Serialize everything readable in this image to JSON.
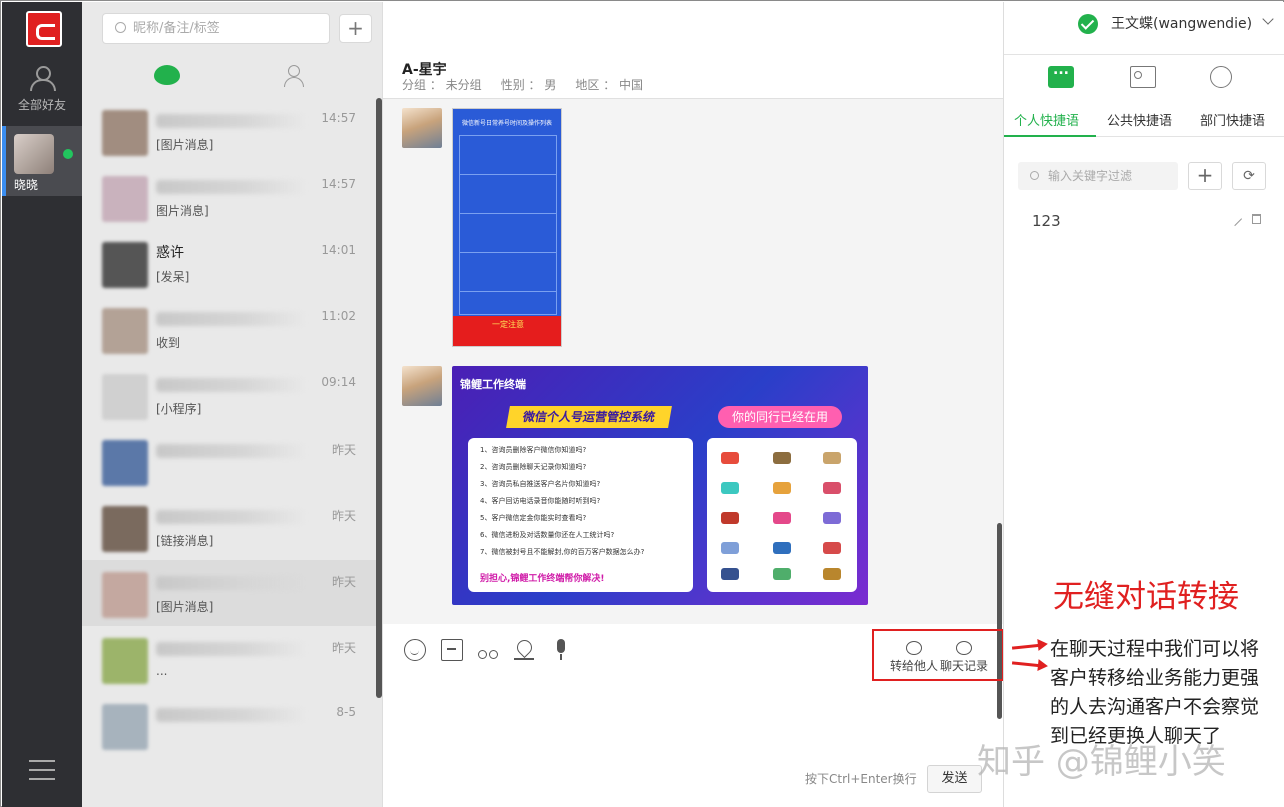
{
  "sidebar": {
    "all_friends_label": "全部好友",
    "user_name": "晓晓"
  },
  "list": {
    "search_placeholder": "昵称/备注/标签",
    "add_label": "+",
    "conversations": [
      {
        "name": "",
        "message": "[图片消息]",
        "time": "14:57",
        "color": "#a18d80"
      },
      {
        "name": "",
        "message": "图片消息]",
        "time": "14:57",
        "color": "#c9b2bd"
      },
      {
        "name": "惑许",
        "message": "[发呆]",
        "time": "14:01",
        "color": "#555555"
      },
      {
        "name": "",
        "message": "收到",
        "time": "11:02",
        "color": "#b3a296"
      },
      {
        "name": "",
        "message": "[小程序]",
        "time": "09:14",
        "color": "#d0d0d0"
      },
      {
        "name": "",
        "message": "",
        "time": "昨天",
        "color": "#5b78a8"
      },
      {
        "name": "",
        "message": "[链接消息]",
        "time": "昨天",
        "color": "#7a6a5e"
      },
      {
        "name": "",
        "message": "[图片消息]",
        "time": "昨天",
        "color": "#c4a8a0"
      },
      {
        "name": "",
        "message": "...",
        "time": "昨天",
        "color": "#9cb46a"
      },
      {
        "name": "",
        "message": "",
        "time": "8-5",
        "color": "#a7b3bd"
      }
    ]
  },
  "chat": {
    "title": "A-星宇",
    "meta": "分组 ： 未分组     性别 ： 男     地区 ： 中国",
    "image1": {
      "title": "微信新号日常养号时间及操作列表",
      "warning": "一定注意"
    },
    "image2": {
      "brand": "锦鲤工作终端",
      "banner_left": "微信个人号运营管控系统",
      "banner_right": "你的同行已经在用",
      "questions": [
        "1、咨询员删除客户微信你知道吗?",
        "2、咨询员删除聊天记录你知道吗?",
        "3、咨询员私自推送客户名片你知道吗?",
        "4、客户回访电话录音你能随时听到吗?",
        "5、客户微信定金你能实时查看吗?",
        "6、微信进粉及对话数量你还在人工统计吗?",
        "7、微信被封号且不能解封,你的百万客户数据怎么办?"
      ],
      "cta": "别担心,锦鲤工作终端帮你解决!"
    },
    "actions": {
      "transfer": "转给他人",
      "history": "聊天记录"
    },
    "hint": "按下Ctrl+Enter换行",
    "send_label": "发送"
  },
  "right": {
    "user": "王文蝶(wangwendie)",
    "tabs": [
      "个人快捷语",
      "公共快捷语",
      "部门快捷语"
    ],
    "search_placeholder": "输入关键字过滤",
    "add_label": "+",
    "refresh_label": "⟳",
    "items": [
      "123"
    ]
  },
  "overlay": {
    "title": "无缝对话转接",
    "text": "在聊天过程中我们可以将客户转移给业务能力更强的人去沟通客户不会察觉到已经更换人聊天了",
    "watermark": "知乎 @锦鲤小笑"
  },
  "colors": {
    "accent": "#22b14c",
    "alert": "#e02020",
    "rail": "#2e2f33"
  }
}
